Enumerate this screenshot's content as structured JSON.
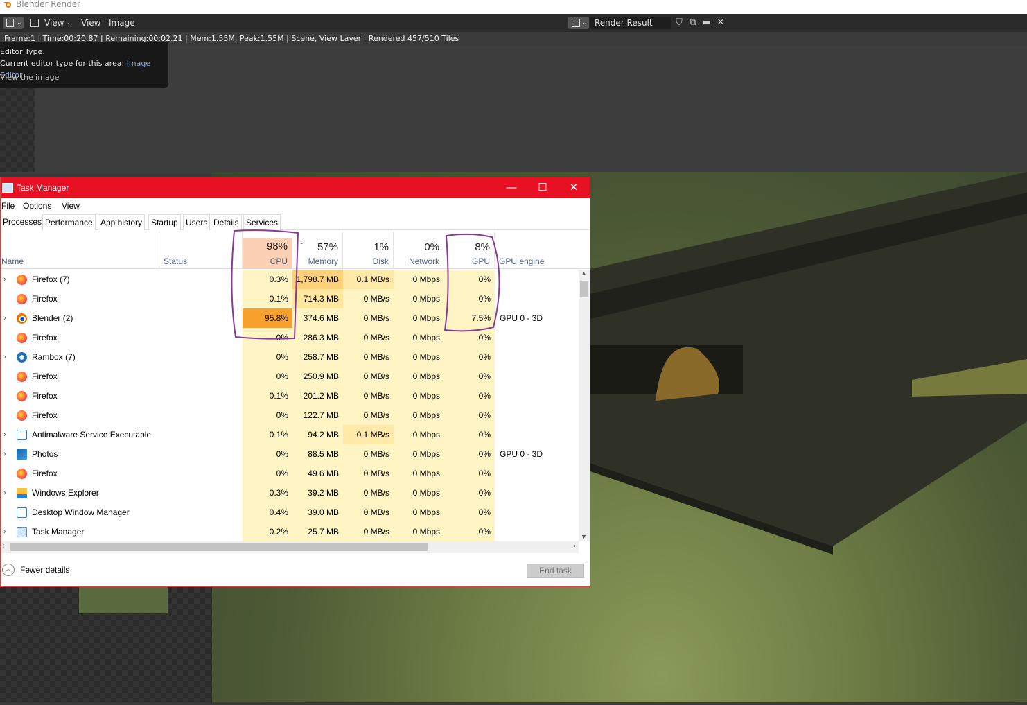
{
  "blender": {
    "window_title": "Blender Render",
    "menu": {
      "view": "View",
      "view2": "View",
      "image": "Image"
    },
    "render_slot": "Render Result",
    "status_line": "Frame:1 | Time:00:20.87 | Remaining:00:02.21 | Mem:1.55M, Peak:1.55M | Scene, View Layer | Rendered 457/510 Tiles",
    "tooltip": {
      "title": "Editor Type.",
      "line2_prefix": "Current editor type for this area:",
      "line2_value": "Image Editor",
      "line3": "View the image"
    }
  },
  "taskmanager": {
    "title": "Task Manager",
    "controls": {
      "minimize": "—",
      "maximize": "☐",
      "close": "✕"
    },
    "menu": [
      "File",
      "Options",
      "View"
    ],
    "tabs": [
      "Processes",
      "Performance",
      "App history",
      "Startup",
      "Users",
      "Details",
      "Services"
    ],
    "columns": {
      "name": "Name",
      "status": "Status",
      "cpu": {
        "pct": "98%",
        "label": "CPU"
      },
      "memory": {
        "pct": "57%",
        "label": "Memory"
      },
      "disk": {
        "pct": "1%",
        "label": "Disk"
      },
      "network": {
        "pct": "0%",
        "label": "Network"
      },
      "gpu": {
        "pct": "8%",
        "label": "GPU"
      },
      "gpu_engine": "GPU engine"
    },
    "processes": [
      {
        "name": "Firefox (7)",
        "expandable": true,
        "icon": "firefox-icon",
        "cpu": "0.3%",
        "memory": "1,798.7 MB",
        "disk": "0.1 MB/s",
        "network": "0 Mbps",
        "gpu": "0%",
        "engine": ""
      },
      {
        "name": "Firefox",
        "expandable": false,
        "icon": "firefox-icon",
        "cpu": "0.1%",
        "memory": "714.3 MB",
        "disk": "0 MB/s",
        "network": "0 Mbps",
        "gpu": "0%",
        "engine": ""
      },
      {
        "name": "Blender (2)",
        "expandable": true,
        "icon": "blender-icon",
        "cpu": "95.8%",
        "memory": "374.6 MB",
        "disk": "0 MB/s",
        "network": "0 Mbps",
        "gpu": "7.5%",
        "engine": "GPU 0 - 3D"
      },
      {
        "name": "Firefox",
        "expandable": false,
        "icon": "firefox-icon",
        "cpu": "0%",
        "memory": "286.3 MB",
        "disk": "0 MB/s",
        "network": "0 Mbps",
        "gpu": "0%",
        "engine": ""
      },
      {
        "name": "Rambox (7)",
        "expandable": true,
        "icon": "rambox-icon",
        "cpu": "0%",
        "memory": "258.7 MB",
        "disk": "0 MB/s",
        "network": "0 Mbps",
        "gpu": "0%",
        "engine": ""
      },
      {
        "name": "Firefox",
        "expandable": false,
        "icon": "firefox-icon",
        "cpu": "0%",
        "memory": "250.9 MB",
        "disk": "0 MB/s",
        "network": "0 Mbps",
        "gpu": "0%",
        "engine": ""
      },
      {
        "name": "Firefox",
        "expandable": false,
        "icon": "firefox-icon",
        "cpu": "0.1%",
        "memory": "201.2 MB",
        "disk": "0 MB/s",
        "network": "0 Mbps",
        "gpu": "0%",
        "engine": ""
      },
      {
        "name": "Firefox",
        "expandable": false,
        "icon": "firefox-icon",
        "cpu": "0%",
        "memory": "122.7 MB",
        "disk": "0 MB/s",
        "network": "0 Mbps",
        "gpu": "0%",
        "engine": ""
      },
      {
        "name": "Antimalware Service Executable",
        "expandable": true,
        "icon": "antimalware-icon",
        "cpu": "0.1%",
        "memory": "94.2 MB",
        "disk": "0.1 MB/s",
        "network": "0 Mbps",
        "gpu": "0%",
        "engine": ""
      },
      {
        "name": "Photos",
        "expandable": true,
        "icon": "photos-icon",
        "cpu": "0%",
        "memory": "88.5 MB",
        "disk": "0 MB/s",
        "network": "0 Mbps",
        "gpu": "0%",
        "engine": "GPU 0 - 3D"
      },
      {
        "name": "Firefox",
        "expandable": false,
        "icon": "firefox-icon",
        "cpu": "0%",
        "memory": "49.6 MB",
        "disk": "0 MB/s",
        "network": "0 Mbps",
        "gpu": "0%",
        "engine": ""
      },
      {
        "name": "Windows Explorer",
        "expandable": true,
        "icon": "folder-icon",
        "cpu": "0.3%",
        "memory": "39.2 MB",
        "disk": "0 MB/s",
        "network": "0 Mbps",
        "gpu": "0%",
        "engine": ""
      },
      {
        "name": "Desktop Window Manager",
        "expandable": false,
        "icon": "dwm-icon",
        "cpu": "0.4%",
        "memory": "39.0 MB",
        "disk": "0 MB/s",
        "network": "0 Mbps",
        "gpu": "0%",
        "engine": ""
      },
      {
        "name": "Task Manager",
        "expandable": true,
        "icon": "task-manager-icon",
        "cpu": "0.2%",
        "memory": "25.7 MB",
        "disk": "0 MB/s",
        "network": "0 Mbps",
        "gpu": "0%",
        "engine": ""
      }
    ],
    "fewer_details": "Fewer details",
    "end_task": "End task"
  },
  "colors": {
    "titlebar_red": "#e81123",
    "cell_light": "#fff4c4",
    "cell_mem_high": "#ffd07a",
    "cell_cpu_high": "#f9a12f",
    "cpu_header": "#fcd0b4",
    "annotation_purple": "#8a3a96"
  }
}
